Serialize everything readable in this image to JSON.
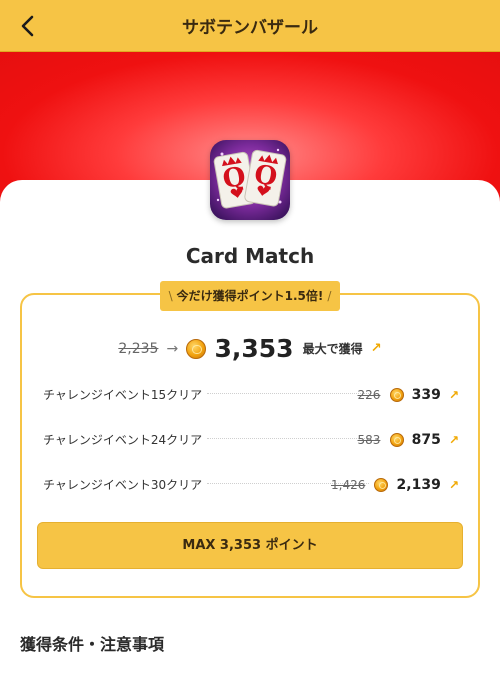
{
  "header": {
    "title": "サボテンバザール",
    "back_icon": "chevron-left-icon"
  },
  "app": {
    "name": "Card Match",
    "icon": "queen-cards-app-icon"
  },
  "promo": {
    "text": "今だけ獲得ポイント1.5倍!"
  },
  "summary": {
    "old_total": "2,235",
    "new_total": "3,353",
    "max_label": "最大で獲得"
  },
  "rows": [
    {
      "label": "チャレンジイベント15クリア",
      "old": "226",
      "new": "339"
    },
    {
      "label": "チャレンジイベント24クリア",
      "old": "583",
      "new": "875"
    },
    {
      "label": "チャレンジイベント30クリア",
      "old": "1,426",
      "new": "2,139"
    }
  ],
  "max_button": {
    "label": "MAX 3,353 ポイント"
  },
  "section": {
    "title": "獲得条件・注意事項"
  },
  "colors": {
    "accent": "#f6c445",
    "hero_red": "#ef1111",
    "arrow_up": "#f0a800"
  }
}
